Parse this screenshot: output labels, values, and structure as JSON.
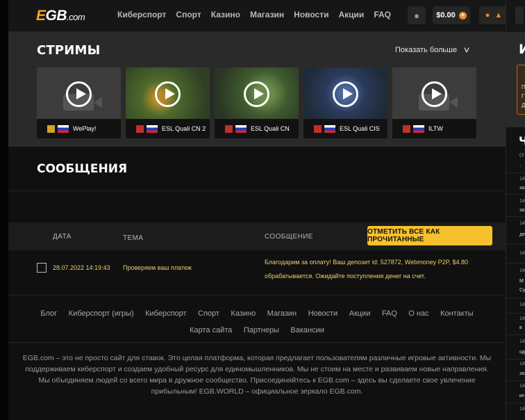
{
  "header": {
    "logo": {
      "e": "E",
      "gb": "GB",
      "com": ".com"
    },
    "nav": [
      "Киберспорт",
      "Спорт",
      "Казино",
      "Магазин",
      "Новости",
      "Акции",
      "FAQ"
    ],
    "balance": "$0.00",
    "balance_plus": "+",
    "icons": [
      "user-icon",
      "apple-icon",
      "android-icon"
    ]
  },
  "streams": {
    "title": "СТРИМЫ",
    "show_more": "Показать больше",
    "cards": [
      {
        "name": "WePlay!",
        "game": "csgo",
        "has_preview": false
      },
      {
        "name": "ESL Quali CN 2",
        "game": "dota2",
        "has_preview": true
      },
      {
        "name": "ESL Quali CN",
        "game": "dota2",
        "has_preview": true
      },
      {
        "name": "ESL Quali CIS",
        "game": "dota2",
        "has_preview": true
      },
      {
        "name": "ILTW",
        "game": "dota2",
        "has_preview": false
      }
    ]
  },
  "messages": {
    "title": "СООБЩЕНИЯ",
    "columns": {
      "date": "ДАТА",
      "topic": "ТЕМА",
      "message": "СООБЩЕНИЕ"
    },
    "mark_all_read": "ОТМЕТИТЬ ВСЕ КАК ПРОЧИТАННЫЕ",
    "rows": [
      {
        "date": "28.07.2022 14:19:43",
        "topic": "Проверяем ваш платеж",
        "message": "Благодарим за оплату! Ваш депозит id: 527872, Webmoney P2P, $4.80 обрабатывается. Ожидайте поступления денег на счет."
      }
    ]
  },
  "footer": {
    "links_line1": [
      "Блог",
      "Киберспорт (игры)",
      "Киберспорт",
      "Спорт",
      "Казино",
      "Магазин",
      "Новости",
      "Акции",
      "FAQ",
      "О нас",
      "Контакты"
    ],
    "links_line2": [
      "Карта сайта",
      "Партнеры",
      "Вакансии"
    ],
    "about": "EGB.com – это не просто сайт для ставок. Это целая платформа, которая предлагает пользователям различные игровые активности. Мы поддерживаем киберспорт и создаем удобный ресурс для единомышленников. Мы не стоим на месте и развиваем новые направления. Мы объединяем людей со всего мира в дружное сообщество. Присоединяйтесь к EGB.com – здесь вы сделаете свое увлечение прибыльным! EGB.WORLD – официальное зеркало EGB.com."
  },
  "sidebar": {
    "letter_top": "И",
    "letter_chat": "Ч",
    "card_letters": [
      "П",
      "Г",
      "Д"
    ],
    "items": [
      "(3",
      "-",
      "14",
      "за",
      "14",
      "за",
      "14",
      "де",
      "14",
      "14",
      "М",
      "Су",
      "14",
      "14",
      "в",
      "14",
      "од",
      "14",
      "за",
      "14",
      "ке",
      "14"
    ]
  },
  "colors": {
    "accent": "#f08a24",
    "button_yellow": "#f6c12c",
    "message_text": "#e8d070",
    "streams_bg": "#2a2a2a"
  }
}
